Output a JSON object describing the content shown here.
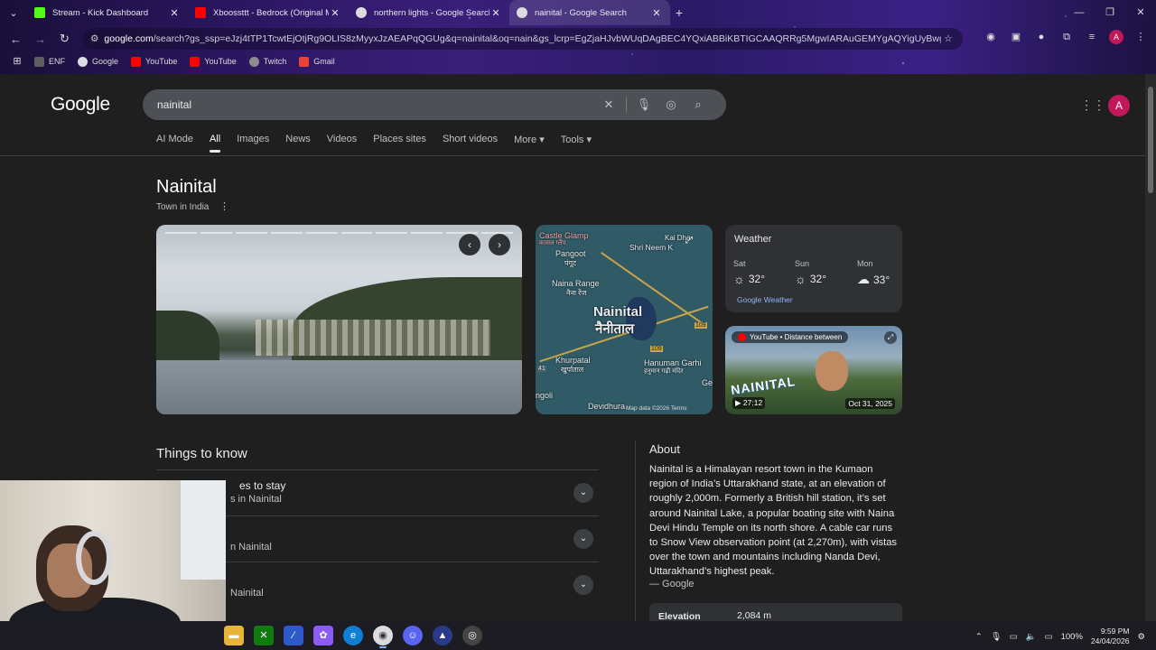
{
  "tabs": [
    {
      "title": "Stream - Kick Dashboard",
      "favicon_color": "#53fc18",
      "active": false
    },
    {
      "title": "Xboossttt - Bedrock (Original M",
      "favicon_color": "#ff0000",
      "active": false
    },
    {
      "title": "northern lights - Google Search",
      "favicon_color": "#dadce0",
      "active": false
    },
    {
      "title": "nainital - Google Search",
      "favicon_color": "#dadce0",
      "active": true
    }
  ],
  "omnibox": {
    "host": "google.com",
    "path": "/search?gs_ssp=eJzj4tTP1TcwtEjOtjRg9OLIS8zMyyxJzAEAPqQGUg&q=nainital&oq=nain&gs_lcrp=EgZjaHJvbWUqDAgBEC4YQxiABBiKBTIGCAAQRRg5MgwIARAuGEMYgAQYigUyBwgCEC..."
  },
  "bookmarks": [
    {
      "label": "ENF",
      "color": "#5e5e5e"
    },
    {
      "label": "Google",
      "color": "#4285f4"
    },
    {
      "label": "YouTube",
      "color": "#ff0000"
    },
    {
      "label": "YouTube",
      "color": "#ff0000"
    },
    {
      "label": "Twitch",
      "color": "#9146ff"
    },
    {
      "label": "Gmail",
      "color": "#ea4335"
    }
  ],
  "search": {
    "logo": "Google",
    "query": "nainital",
    "avatar_letter": "A"
  },
  "filters": [
    "AI Mode",
    "All",
    "Images",
    "News",
    "Videos",
    "Places sites",
    "Short videos",
    "More ▾",
    "Tools ▾"
  ],
  "active_filter": "All",
  "knowledge": {
    "title": "Nainital",
    "subtitle": "Town in India",
    "map": {
      "labels": {
        "castle": "Castle Glamp",
        "castle_hi": "कासल ग्लैंप",
        "pangoot": "Pangoot",
        "pangoot_hi": "पंगूट",
        "shri_neem": "Shri Neem K",
        "kainchi": "Kai  Dha",
        "naina_range": "Naina Range",
        "naina_range_hi": "नैना रेंज",
        "city": "Nainital",
        "city_hi": "नैनीताल",
        "khurpatal": "Khurpatal",
        "khurpatal_hi": "खुर्पाताल",
        "hanuman": "Hanuman Garhi",
        "hanuman_hi": "हनुमान गढ़ी मंदिर",
        "devidhura": "Devidhura",
        "angoli": "ngoli",
        "ge": "Ge",
        "road109": "109",
        "road109b": "109",
        "road41": "41"
      },
      "footer": "Map data ©2026    Terms"
    },
    "weather": {
      "title": "Weather",
      "days": [
        {
          "day": "Sat",
          "temp": "32°",
          "icon": "sun-icon"
        },
        {
          "day": "Sun",
          "temp": "32°",
          "icon": "sun-icon"
        },
        {
          "day": "Mon",
          "temp": "33°",
          "icon": "cloud-icon"
        }
      ],
      "source": "Google Weather"
    },
    "video": {
      "chip": "YouTube • Distance between",
      "banner": "NAINITAL",
      "duration": "▶ 27:12",
      "date": "Oct 31, 2025"
    }
  },
  "things_to_know": {
    "heading": "Things to know",
    "rows": [
      {
        "title": "es to stay",
        "subtitle": "s in Nainital"
      },
      {
        "title": "",
        "subtitle": "n Nainital"
      },
      {
        "title": "",
        "subtitle": "Nainital"
      }
    ]
  },
  "about": {
    "heading": "About",
    "text": "Nainital is a Himalayan resort town in the Kumaon region of India’s Uttarakhand state, at an elevation of roughly 2,000m. Formerly a British hill station, it’s set around Nainital Lake, a popular boating site with Naina Devi Hindu Temple on its north shore. A cable car runs to Snow View observation point (at 2,270m), with vistas over the town and mountains including Nanda Devi, Uttarakhand’s highest peak.",
    "source": "— Google",
    "elevation_label": "Elevation",
    "elevation_value": "2,084 m"
  },
  "taskbar": {
    "battery": "100%",
    "time": "9:59 PM",
    "date": "24/04/2026"
  }
}
